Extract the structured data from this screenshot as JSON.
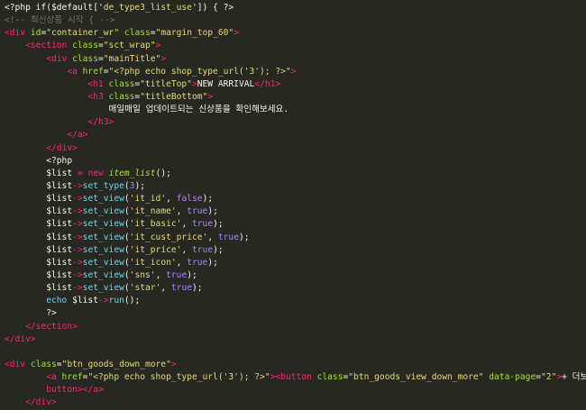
{
  "editor": {
    "theme": "monokai",
    "colors": {
      "background": "#272822",
      "text": "#f8f8f2",
      "tag": "#f92672",
      "attr": "#a6e22e",
      "string": "#e6db74",
      "comment": "#75715e",
      "number": "#ae81ff",
      "function": "#66d9ef"
    },
    "lines": [
      {
        "indent": "",
        "tokens": [
          [
            "php",
            "<?php if($default['"
          ],
          [
            "str",
            "de_type3_list_use"
          ],
          [
            "php",
            "']) { ?>"
          ]
        ]
      },
      {
        "indent": "",
        "tokens": [
          [
            "comment",
            "<!-- 최신상품 시작 { -->"
          ]
        ]
      },
      {
        "indent": "",
        "tokens": [
          [
            "tag",
            "<div "
          ],
          [
            "attr",
            "id"
          ],
          [
            "plain",
            "="
          ],
          [
            "str",
            "\"container_wr\""
          ],
          [
            "plain",
            " "
          ],
          [
            "attr",
            "class"
          ],
          [
            "plain",
            "="
          ],
          [
            "str",
            "\"margin_top_60\""
          ],
          [
            "tag",
            ">"
          ]
        ]
      },
      {
        "indent": "    ",
        "tokens": [
          [
            "tag",
            "<section "
          ],
          [
            "attr",
            "class"
          ],
          [
            "plain",
            "="
          ],
          [
            "str",
            "\"sct_wrap\""
          ],
          [
            "tag",
            ">"
          ]
        ]
      },
      {
        "indent": "        ",
        "tokens": [
          [
            "tag",
            "<div "
          ],
          [
            "attr",
            "class"
          ],
          [
            "plain",
            "="
          ],
          [
            "str",
            "\"mainTitle\""
          ],
          [
            "tag",
            ">"
          ]
        ]
      },
      {
        "indent": "            ",
        "tokens": [
          [
            "tag",
            "<a "
          ],
          [
            "attr",
            "href"
          ],
          [
            "plain",
            "="
          ],
          [
            "str",
            "\"<?php echo shop_type_url('3'); ?>\""
          ],
          [
            "tag",
            ">"
          ]
        ]
      },
      {
        "indent": "                ",
        "tokens": [
          [
            "tag",
            "<h1 "
          ],
          [
            "attr",
            "class"
          ],
          [
            "plain",
            "="
          ],
          [
            "str",
            "\"titleTop\""
          ],
          [
            "tag",
            ">"
          ],
          [
            "plain",
            "NEW ARRIVAL"
          ],
          [
            "tag",
            "</h1>"
          ]
        ]
      },
      {
        "indent": "                ",
        "tokens": [
          [
            "tag",
            "<h3 "
          ],
          [
            "attr",
            "class"
          ],
          [
            "plain",
            "="
          ],
          [
            "str",
            "\"titleBottom\""
          ],
          [
            "tag",
            ">"
          ]
        ]
      },
      {
        "indent": "                    ",
        "tokens": [
          [
            "plain",
            "매일매일 업데이트되는 신상품을 확인해보세요."
          ]
        ]
      },
      {
        "indent": "                ",
        "tokens": [
          [
            "tag",
            "</h3>"
          ]
        ]
      },
      {
        "indent": "            ",
        "tokens": [
          [
            "tag",
            "</a>"
          ]
        ]
      },
      {
        "indent": "        ",
        "tokens": [
          [
            "tag",
            "</div>"
          ]
        ]
      },
      {
        "indent": "        ",
        "tokens": [
          [
            "php",
            "<?php"
          ]
        ]
      },
      {
        "indent": "        ",
        "tokens": [
          [
            "var",
            "$list"
          ],
          [
            "plain",
            " "
          ],
          [
            "op",
            "="
          ],
          [
            "plain",
            " "
          ],
          [
            "kw",
            "new"
          ],
          [
            "plain",
            " "
          ],
          [
            "class",
            "item_list"
          ],
          [
            "plain",
            "();"
          ]
        ]
      },
      {
        "indent": "        ",
        "tokens": [
          [
            "var",
            "$list"
          ],
          [
            "op",
            "->"
          ],
          [
            "fn",
            "set_type"
          ],
          [
            "plain",
            "("
          ],
          [
            "num",
            "3"
          ],
          [
            "plain",
            ");"
          ]
        ]
      },
      {
        "indent": "        ",
        "tokens": [
          [
            "var",
            "$list"
          ],
          [
            "op",
            "->"
          ],
          [
            "fn",
            "set_view"
          ],
          [
            "plain",
            "("
          ],
          [
            "str",
            "'it_id'"
          ],
          [
            "plain",
            ", "
          ],
          [
            "bool",
            "false"
          ],
          [
            "plain",
            ");"
          ]
        ]
      },
      {
        "indent": "        ",
        "tokens": [
          [
            "var",
            "$list"
          ],
          [
            "op",
            "->"
          ],
          [
            "fn",
            "set_view"
          ],
          [
            "plain",
            "("
          ],
          [
            "str",
            "'it_name'"
          ],
          [
            "plain",
            ", "
          ],
          [
            "bool",
            "true"
          ],
          [
            "plain",
            ");"
          ]
        ]
      },
      {
        "indent": "        ",
        "tokens": [
          [
            "var",
            "$list"
          ],
          [
            "op",
            "->"
          ],
          [
            "fn",
            "set_view"
          ],
          [
            "plain",
            "("
          ],
          [
            "str",
            "'it_basic'"
          ],
          [
            "plain",
            ", "
          ],
          [
            "bool",
            "true"
          ],
          [
            "plain",
            ");"
          ]
        ]
      },
      {
        "indent": "        ",
        "tokens": [
          [
            "var",
            "$list"
          ],
          [
            "op",
            "->"
          ],
          [
            "fn",
            "set_view"
          ],
          [
            "plain",
            "("
          ],
          [
            "str",
            "'it_cust_price'"
          ],
          [
            "plain",
            ", "
          ],
          [
            "bool",
            "true"
          ],
          [
            "plain",
            ");"
          ]
        ]
      },
      {
        "indent": "        ",
        "tokens": [
          [
            "var",
            "$list"
          ],
          [
            "op",
            "->"
          ],
          [
            "fn",
            "set_view"
          ],
          [
            "plain",
            "("
          ],
          [
            "str",
            "'it_price'"
          ],
          [
            "plain",
            ", "
          ],
          [
            "bool",
            "true"
          ],
          [
            "plain",
            ");"
          ]
        ]
      },
      {
        "indent": "        ",
        "tokens": [
          [
            "var",
            "$list"
          ],
          [
            "op",
            "->"
          ],
          [
            "fn",
            "set_view"
          ],
          [
            "plain",
            "("
          ],
          [
            "str",
            "'it_icon'"
          ],
          [
            "plain",
            ", "
          ],
          [
            "bool",
            "true"
          ],
          [
            "plain",
            ");"
          ]
        ]
      },
      {
        "indent": "        ",
        "tokens": [
          [
            "var",
            "$list"
          ],
          [
            "op",
            "->"
          ],
          [
            "fn",
            "set_view"
          ],
          [
            "plain",
            "("
          ],
          [
            "str",
            "'sns'"
          ],
          [
            "plain",
            ", "
          ],
          [
            "bool",
            "true"
          ],
          [
            "plain",
            ");"
          ]
        ]
      },
      {
        "indent": "        ",
        "tokens": [
          [
            "var",
            "$list"
          ],
          [
            "op",
            "->"
          ],
          [
            "fn",
            "set_view"
          ],
          [
            "plain",
            "("
          ],
          [
            "str",
            "'star'"
          ],
          [
            "plain",
            ", "
          ],
          [
            "bool",
            "true"
          ],
          [
            "plain",
            ");"
          ]
        ]
      },
      {
        "indent": "        ",
        "tokens": [
          [
            "fn",
            "echo"
          ],
          [
            "plain",
            " "
          ],
          [
            "var",
            "$list"
          ],
          [
            "op",
            "->"
          ],
          [
            "fn",
            "run"
          ],
          [
            "plain",
            "();"
          ]
        ]
      },
      {
        "indent": "        ",
        "tokens": [
          [
            "php",
            "?>"
          ]
        ]
      },
      {
        "indent": "    ",
        "tokens": [
          [
            "tag",
            "</section>"
          ]
        ]
      },
      {
        "indent": "",
        "tokens": [
          [
            "tag",
            "</div>"
          ]
        ]
      },
      {
        "indent": "",
        "tokens": []
      },
      {
        "indent": "",
        "tokens": [
          [
            "tag",
            "<div "
          ],
          [
            "attr",
            "class"
          ],
          [
            "plain",
            "="
          ],
          [
            "str",
            "\"btn_goods_down_more\""
          ],
          [
            "tag",
            ">"
          ]
        ]
      },
      {
        "indent": "        ",
        "tokens": [
          [
            "tag",
            "<a "
          ],
          [
            "attr",
            "href"
          ],
          [
            "plain",
            "="
          ],
          [
            "str",
            "\"<?php echo shop_type_url('3'); ?>\""
          ],
          [
            "tag",
            ">"
          ],
          [
            "tag",
            "<button "
          ],
          [
            "attr",
            "class"
          ],
          [
            "plain",
            "="
          ],
          [
            "str",
            "\"btn_goods_view_down_more\""
          ],
          [
            "plain",
            " "
          ],
          [
            "attr",
            "data-page"
          ],
          [
            "plain",
            "="
          ],
          [
            "str",
            "\"2\""
          ],
          [
            "tag",
            ">"
          ],
          [
            "plain",
            "+ 더보기"
          ],
          [
            "tag",
            "</"
          ]
        ]
      },
      {
        "indent": "        ",
        "tokens": [
          [
            "tag",
            "button>"
          ],
          [
            "tag",
            "</a>"
          ]
        ]
      },
      {
        "indent": "    ",
        "tokens": [
          [
            "tag",
            "</div>"
          ]
        ]
      }
    ]
  }
}
